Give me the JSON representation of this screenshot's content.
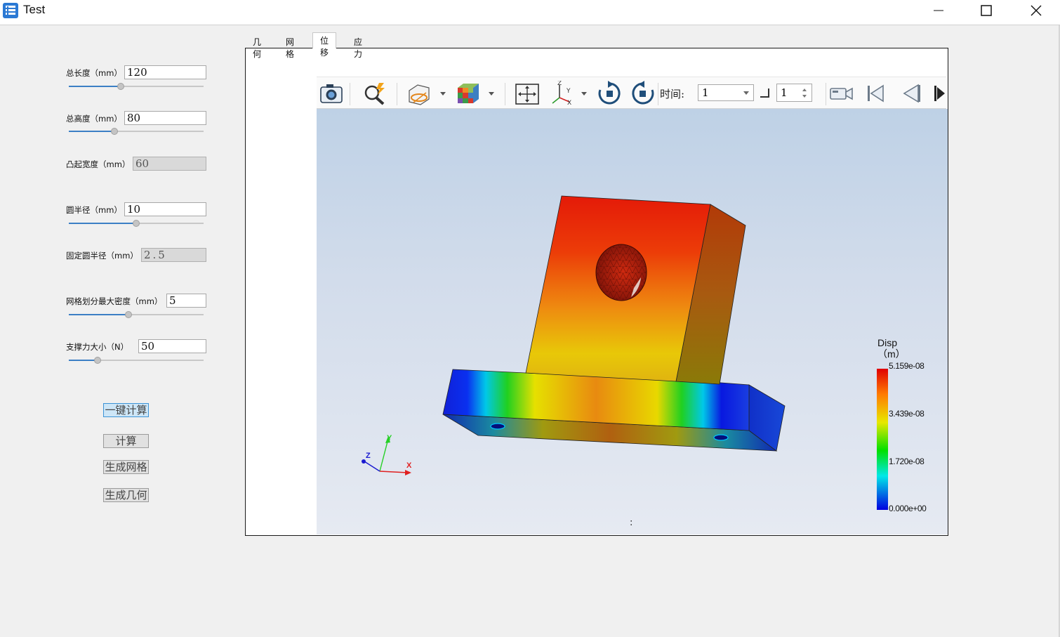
{
  "window": {
    "title": "Test"
  },
  "parameters": [
    {
      "label": "总长度（mm）",
      "value": "120",
      "enabled": true,
      "slider": 0.38
    },
    {
      "label": "总高度（mm）",
      "value": "80",
      "enabled": true,
      "slider": 0.33
    },
    {
      "label": "凸起宽度（mm）",
      "value": "60",
      "enabled": false
    },
    {
      "label": "圆半径（mm）",
      "value": "10",
      "enabled": true,
      "slider": 0.5
    },
    {
      "label": "固定圆半径（mm）",
      "value": "2.5",
      "enabled": false
    },
    {
      "label": "网格划分最大密度（mm）",
      "value": "5",
      "enabled": true,
      "slider": 0.44
    },
    {
      "label": "支撑力大小（N）",
      "value": "50",
      "enabled": true,
      "slider": 0.2
    }
  ],
  "actions": {
    "one_click_compute": "一键计算",
    "compute": "计算",
    "generate_mesh": "生成网格",
    "generate_geometry": "生成几何"
  },
  "tabs": [
    {
      "label": "几何",
      "active": false
    },
    {
      "label": "网格",
      "active": false
    },
    {
      "label": "位移",
      "active": true
    },
    {
      "label": "应力",
      "active": false
    }
  ],
  "toolbar": {
    "icons": [
      "camera-icon",
      "zoom-icon",
      "clip-plane-icon",
      "color-cube-icon",
      "fit-view-icon",
      "axes-icon",
      "rotate-cw-icon",
      "rotate-ccw-icon",
      "record-icon",
      "first-frame-icon",
      "prev-frame-icon",
      "next-frame-icon"
    ],
    "time_label": "时间:",
    "time_value": "1",
    "frame_value": "1"
  },
  "legend": {
    "title_line1": "Disp",
    "title_line2": "（m）",
    "max": "5.159e-08",
    "mid_high": "3.439e-08",
    "mid_low": "1.720e-08",
    "min": "0.000e+00",
    "colors": [
      "#e00000",
      "#ff7a00",
      "#e8e800",
      "#00e000",
      "#00e8e8",
      "#0000e0"
    ]
  },
  "axes": {
    "x": "X",
    "y": "Y",
    "z": "Z"
  },
  "viewport_status": ":"
}
